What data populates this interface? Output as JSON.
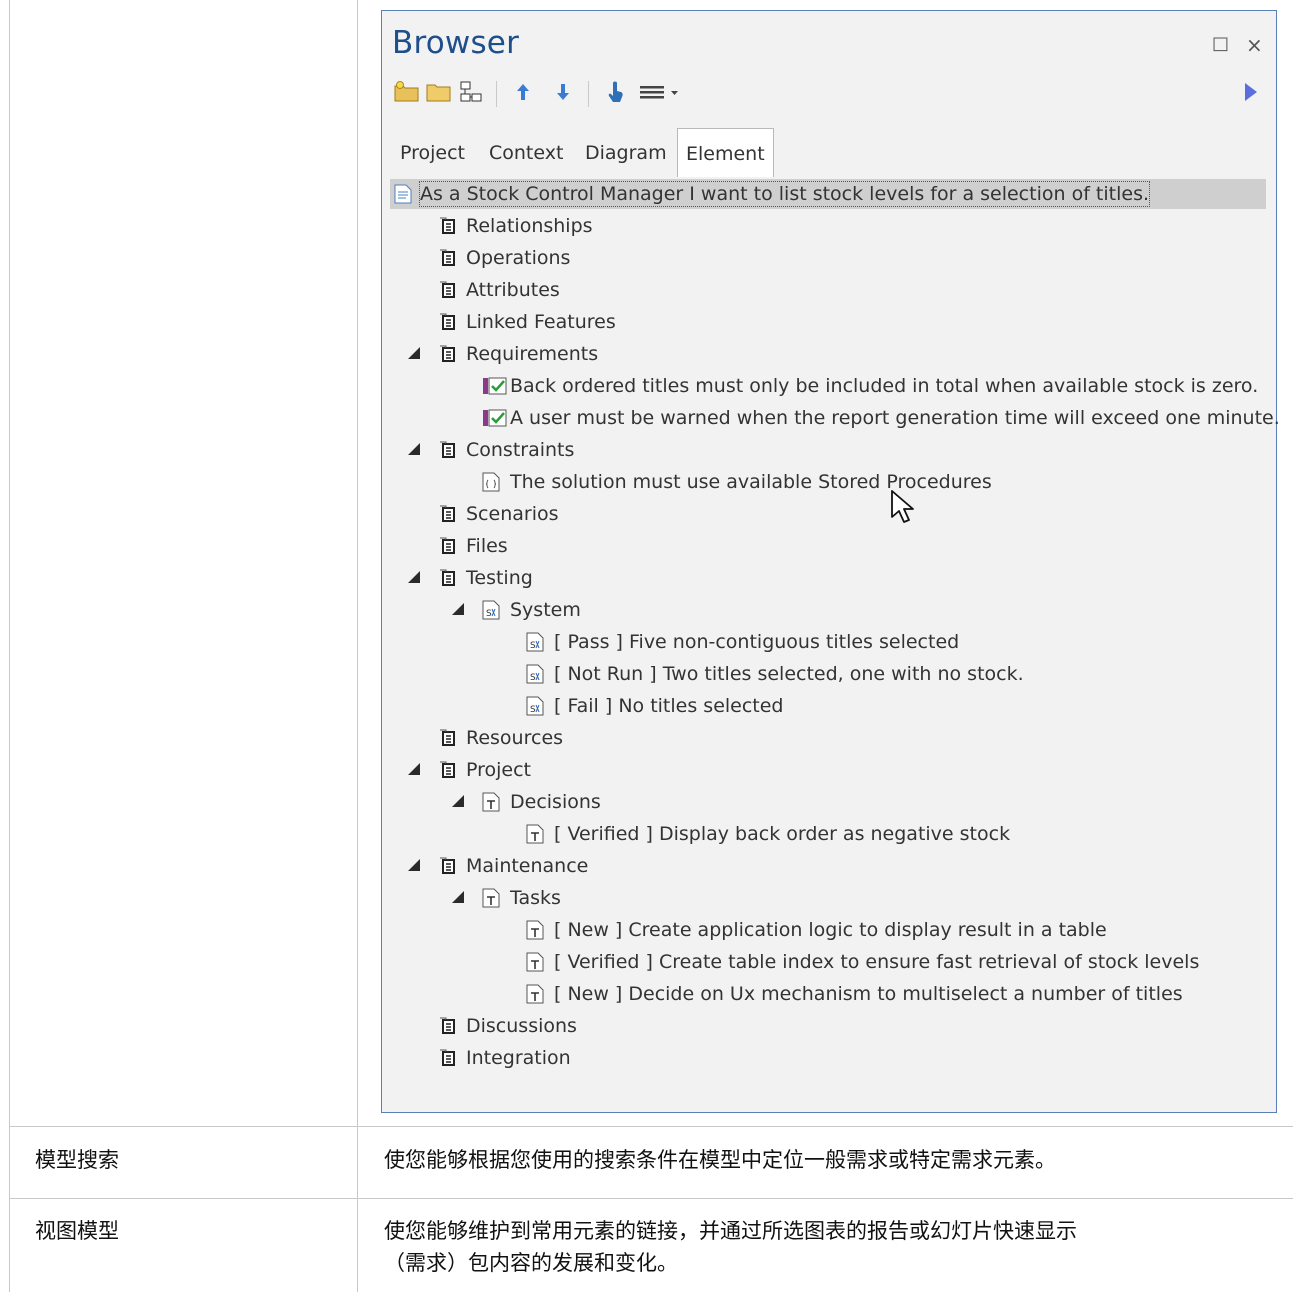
{
  "browser": {
    "title": "Browser",
    "window_controls": {
      "maximize": "□",
      "close": "×"
    },
    "tabs": [
      "Project",
      "Context",
      "Diagram",
      "Element"
    ],
    "active_tab": "Element",
    "root": "As a Stock Control Manager I want to list stock levels for a selection of titles.",
    "tree": {
      "relationships": "Relationships",
      "operations": "Operations",
      "attributes": "Attributes",
      "linked_features": "Linked Features",
      "requirements": "Requirements",
      "req1": "Back ordered titles must only be included in total when available stock is zero.",
      "req2": "A user must be warned when the report generation time will exceed one minute.",
      "constraints": "Constraints",
      "con1": "The solution must use available Stored Procedures",
      "scenarios": "Scenarios",
      "files": "Files",
      "testing": "Testing",
      "system": "System",
      "test1": "[ Pass ] Five non-contiguous titles selected",
      "test2": "[ Not Run ] Two titles selected, one with no stock.",
      "test3": "[ Fail ] No titles selected",
      "resources": "Resources",
      "project": "Project",
      "decisions": "Decisions",
      "dec1": "[ Verified ] Display back order as negative stock",
      "maintenance": "Maintenance",
      "tasks": "Tasks",
      "task1": "[ New ] Create application logic to display result in a table",
      "task2": "[ Verified ] Create table index to ensure fast retrieval of stock levels",
      "task3": "[ New ] Decide on Ux mechanism to multiselect a number of titles",
      "discussions": "Discussions",
      "integration": "Integration"
    }
  },
  "table": {
    "row1": {
      "label": "模型搜索",
      "desc": "使您能够根据您使用的搜索条件在模型中定位一般需求或特定需求元素。"
    },
    "row2": {
      "label": "视图模型",
      "desc_line1": "使您能够维护到常用元素的链接，并通过所选图表的报告或幻灯片快速显示",
      "desc_line2": "（需求）包内容的发展和变化。"
    }
  },
  "colors": {
    "title_blue": "#1f4e8c",
    "accent_blue": "#5b6ee0",
    "check_green": "#2a9d3b",
    "req_purple": "#8b3a8b"
  }
}
